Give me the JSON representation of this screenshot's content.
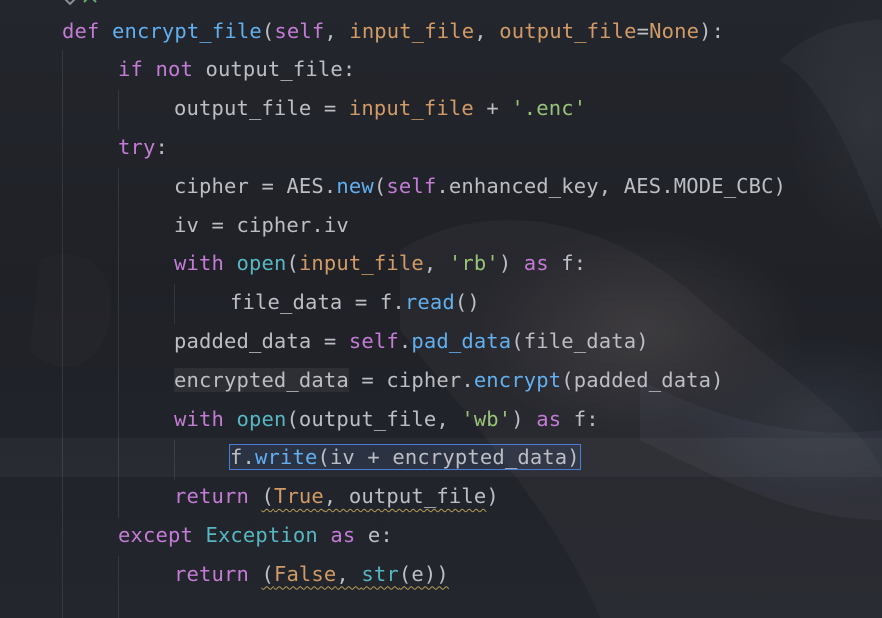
{
  "editor": {
    "language": "python",
    "lines": [
      {
        "indent": 0,
        "tokens": [
          {
            "t": "def ",
            "c": "purple"
          },
          {
            "t": "encrypt_file",
            "c": "blue"
          },
          {
            "t": "(",
            "c": "plain"
          },
          {
            "t": "self",
            "c": "purple"
          },
          {
            "t": ", ",
            "c": "plain"
          },
          {
            "t": "input_file",
            "c": "orange"
          },
          {
            "t": ", ",
            "c": "plain"
          },
          {
            "t": "output_file",
            "c": "orange"
          },
          {
            "t": "=",
            "c": "plain"
          },
          {
            "t": "None",
            "c": "orange"
          },
          {
            "t": "):",
            "c": "plain"
          }
        ]
      },
      {
        "indent": 1,
        "tokens": [
          {
            "t": "if ",
            "c": "purple"
          },
          {
            "t": "not ",
            "c": "purple"
          },
          {
            "t": "output_file",
            "c": "plain"
          },
          {
            "t": ":",
            "c": "plain"
          }
        ]
      },
      {
        "indent": 2,
        "tokens": [
          {
            "t": "output_file",
            "c": "plain"
          },
          {
            "t": " = ",
            "c": "plain"
          },
          {
            "t": "input_file",
            "c": "orange"
          },
          {
            "t": " + ",
            "c": "plain"
          },
          {
            "t": "'.enc'",
            "c": "green"
          }
        ]
      },
      {
        "indent": 1,
        "tokens": [
          {
            "t": "try",
            "c": "purple"
          },
          {
            "t": ":",
            "c": "plain"
          }
        ]
      },
      {
        "indent": 2,
        "tokens": [
          {
            "t": "cipher",
            "c": "plain"
          },
          {
            "t": " = ",
            "c": "plain"
          },
          {
            "t": "AES",
            "c": "plain"
          },
          {
            "t": ".",
            "c": "plain"
          },
          {
            "t": "new",
            "c": "blue"
          },
          {
            "t": "(",
            "c": "plain"
          },
          {
            "t": "self",
            "c": "purple"
          },
          {
            "t": ".enhanced_key, AES.MODE_CBC)",
            "c": "plain"
          }
        ]
      },
      {
        "indent": 2,
        "tokens": [
          {
            "t": "iv = cipher.iv",
            "c": "plain"
          }
        ]
      },
      {
        "indent": 2,
        "tokens": [
          {
            "t": "with ",
            "c": "purple"
          },
          {
            "t": "open",
            "c": "cyan"
          },
          {
            "t": "(",
            "c": "plain"
          },
          {
            "t": "input_file",
            "c": "orange"
          },
          {
            "t": ", ",
            "c": "plain"
          },
          {
            "t": "'rb'",
            "c": "green"
          },
          {
            "t": ") ",
            "c": "plain"
          },
          {
            "t": "as ",
            "c": "purple"
          },
          {
            "t": "f:",
            "c": "plain"
          }
        ]
      },
      {
        "indent": 3,
        "tokens": [
          {
            "t": "file_data = f.",
            "c": "plain"
          },
          {
            "t": "read",
            "c": "blue"
          },
          {
            "t": "()",
            "c": "plain"
          }
        ]
      },
      {
        "indent": 2,
        "tokens": [
          {
            "t": "padded_data = ",
            "c": "plain"
          },
          {
            "t": "self",
            "c": "purple"
          },
          {
            "t": ".",
            "c": "plain"
          },
          {
            "t": "pad_data",
            "c": "blue"
          },
          {
            "t": "(file_data)",
            "c": "plain"
          }
        ]
      },
      {
        "indent": 2,
        "tokens": [
          {
            "t": "encrypted_data",
            "c": "plain",
            "occ": true
          },
          {
            "t": " = cipher.",
            "c": "plain"
          },
          {
            "t": "encrypt",
            "c": "blue"
          },
          {
            "t": "(padded_data)",
            "c": "plain"
          }
        ]
      },
      {
        "indent": 2,
        "tokens": [
          {
            "t": "with ",
            "c": "purple"
          },
          {
            "t": "open",
            "c": "cyan"
          },
          {
            "t": "(output_file, ",
            "c": "plain"
          },
          {
            "t": "'wb'",
            "c": "green"
          },
          {
            "t": ") ",
            "c": "plain"
          },
          {
            "t": "as ",
            "c": "purple"
          },
          {
            "t": "f:",
            "c": "plain"
          }
        ]
      },
      {
        "indent": 3,
        "selected": true,
        "current": true,
        "tokens": [
          {
            "t": "f.",
            "c": "plain"
          },
          {
            "t": "write",
            "c": "blue"
          },
          {
            "t": "(iv + encrypted_data)",
            "c": "plain"
          }
        ]
      },
      {
        "indent": 2,
        "tokens": [
          {
            "t": "return ",
            "c": "purple"
          },
          {
            "t": "(",
            "c": "plain",
            "sq": true
          },
          {
            "t": "True",
            "c": "orange",
            "sq": true
          },
          {
            "t": ", output_file",
            "c": "plain",
            "sq": true
          },
          {
            "t": ")",
            "c": "plain"
          }
        ]
      },
      {
        "indent": 1,
        "tokens": [
          {
            "t": "except ",
            "c": "purple"
          },
          {
            "t": "Exception ",
            "c": "cyan"
          },
          {
            "t": "as ",
            "c": "purple"
          },
          {
            "t": "e:",
            "c": "plain"
          }
        ]
      },
      {
        "indent": 2,
        "tokens": [
          {
            "t": "return ",
            "c": "purple"
          },
          {
            "t": "(",
            "c": "plain",
            "sq": true
          },
          {
            "t": "False",
            "c": "orange",
            "sq": true
          },
          {
            "t": ", ",
            "c": "plain",
            "sq": true
          },
          {
            "t": "str",
            "c": "cyan",
            "sq": true
          },
          {
            "t": "(e))",
            "c": "plain",
            "sq": true
          }
        ]
      }
    ]
  }
}
